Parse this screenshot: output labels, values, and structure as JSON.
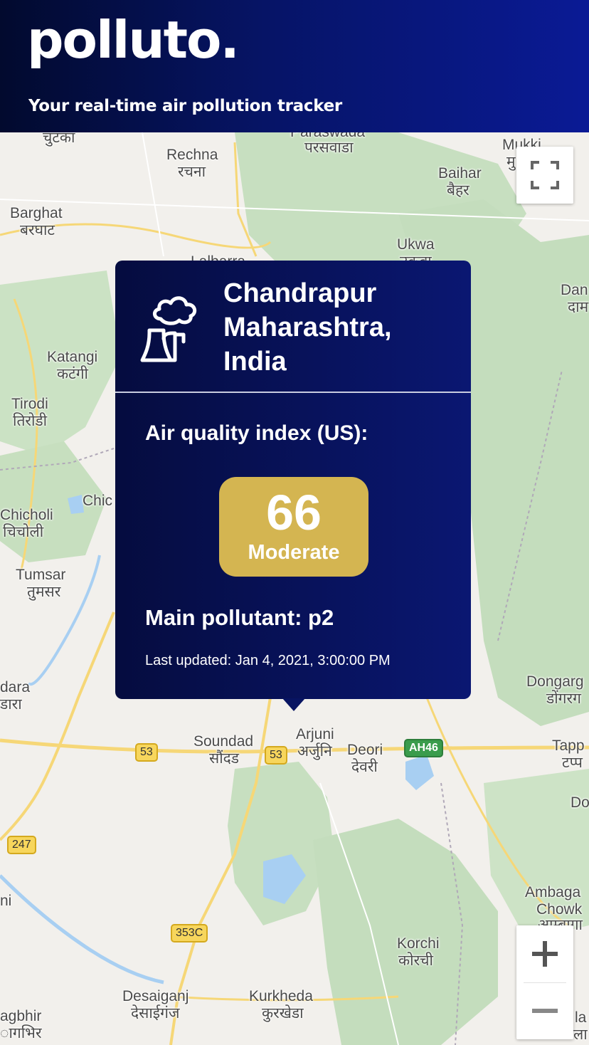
{
  "app": {
    "logo": "polluto.",
    "tagline": "Your real-time air pollution tracker"
  },
  "map": {
    "places": [
      {
        "name": "चुटका"
      },
      {
        "name": "Paraswada"
      },
      {
        "name": "परसवाडा"
      },
      {
        "name": "Mukki"
      },
      {
        "name": "मु"
      },
      {
        "name": "Rechna"
      },
      {
        "name": "रचना"
      },
      {
        "name": "Baihar"
      },
      {
        "name": "बैहर"
      },
      {
        "name": "Barghat"
      },
      {
        "name": "बरघाट"
      },
      {
        "name": "Ukwa"
      },
      {
        "name": "उकवा"
      },
      {
        "name": "Lalbarra"
      },
      {
        "name": "Dan"
      },
      {
        "name": "दाम"
      },
      {
        "name": "Katangi"
      },
      {
        "name": "कटंगी"
      },
      {
        "name": "Tirodi"
      },
      {
        "name": "तिरोडी"
      },
      {
        "name": "Chic"
      },
      {
        "name": "Chicholi"
      },
      {
        "name": "चिचोली"
      },
      {
        "name": "Tumsar"
      },
      {
        "name": "तुमसर"
      },
      {
        "name": "dara"
      },
      {
        "name": "डारा"
      },
      {
        "name": "Soundad"
      },
      {
        "name": "सौंदड"
      },
      {
        "name": "Arjuni"
      },
      {
        "name": "अर्जुनि"
      },
      {
        "name": "Deori"
      },
      {
        "name": "देवरी"
      },
      {
        "name": "Dongarg"
      },
      {
        "name": "डोंगरग"
      },
      {
        "name": "Tapp"
      },
      {
        "name": "टप्प"
      },
      {
        "name": "Do"
      },
      {
        "name": "Ambaga"
      },
      {
        "name": "Chowk"
      },
      {
        "name": "आम्बागा"
      },
      {
        "name": "Korchi"
      },
      {
        "name": "कोरची"
      },
      {
        "name": "Desaiganj"
      },
      {
        "name": "देसाईगंज"
      },
      {
        "name": "Kurkheda"
      },
      {
        "name": "कुरखेडा"
      },
      {
        "name": "agbhir"
      },
      {
        "name": "ागभिर"
      },
      {
        "name": "ni"
      },
      {
        "name": "la"
      },
      {
        "name": "ला"
      }
    ],
    "road_shields": [
      {
        "label": "53"
      },
      {
        "label": "53"
      },
      {
        "label": "AH46"
      },
      {
        "label": "247"
      },
      {
        "label": "353C"
      }
    ],
    "controls": {
      "fullscreen_icon": "fullscreen-icon",
      "zoom_in_label": "+",
      "zoom_out_label": "−"
    }
  },
  "popup": {
    "icon": "factory-icon",
    "city_line1": "Chandrapur",
    "city_line2": "Maharashtra,",
    "city_line3": "India",
    "aqi_label": "Air quality index (US):",
    "aqi_value": "66",
    "aqi_status": "Moderate",
    "aqi_color": "#d4b551",
    "main_pollutant": "Main pollutant: p2",
    "last_updated": "Last updated: Jan 4, 2021, 3:00:00 PM"
  }
}
